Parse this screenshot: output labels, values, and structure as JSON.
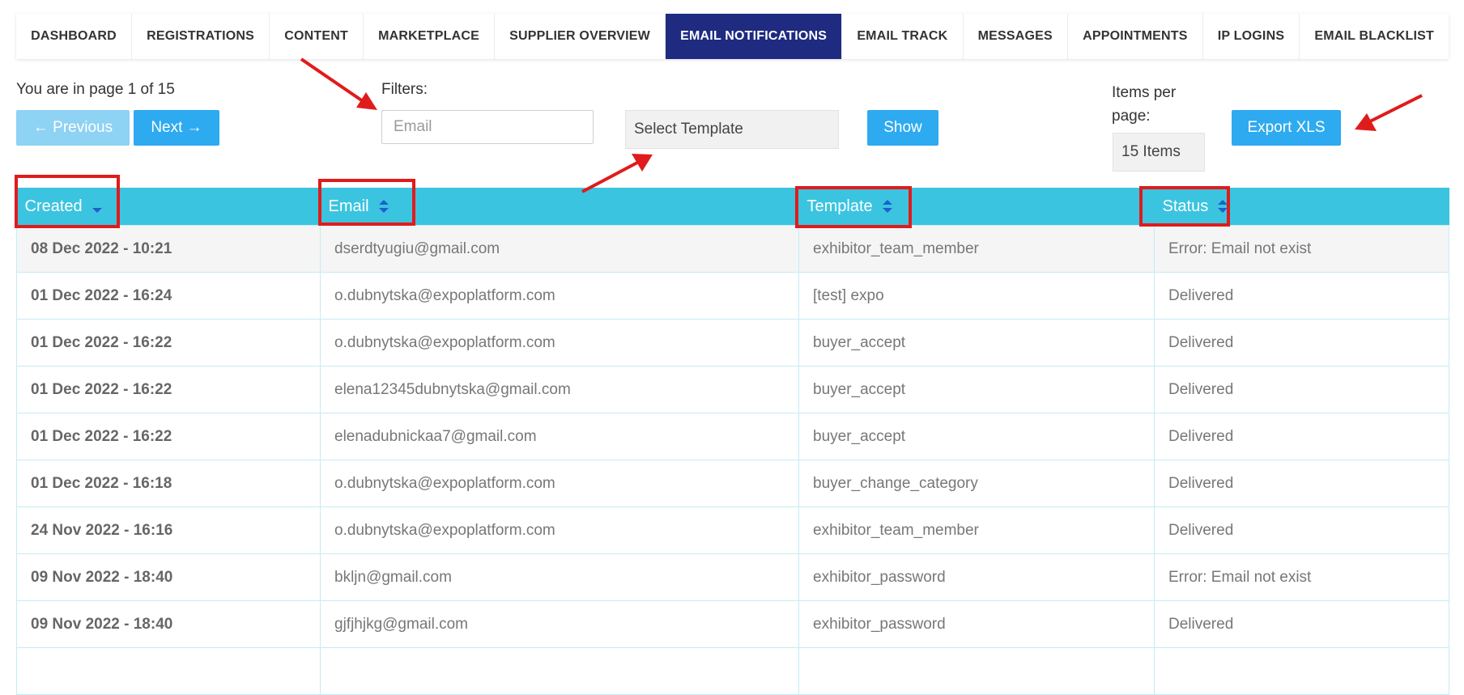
{
  "tabs": [
    {
      "label": "DASHBOARD"
    },
    {
      "label": "REGISTRATIONS"
    },
    {
      "label": "CONTENT"
    },
    {
      "label": "MARKETPLACE"
    },
    {
      "label": "SUPPLIER OVERVIEW"
    },
    {
      "label": "EMAIL NOTIFICATIONS"
    },
    {
      "label": "EMAIL TRACK"
    },
    {
      "label": "MESSAGES"
    },
    {
      "label": "APPOINTMENTS"
    },
    {
      "label": "IP LOGINS"
    },
    {
      "label": "EMAIL BLACKLIST"
    }
  ],
  "active_tab": "EMAIL NOTIFICATIONS",
  "pagination": {
    "page_info": "You are in page 1 of 15",
    "prev_label": "← Previous",
    "next_label": "Next →"
  },
  "filters": {
    "label": "Filters:",
    "email_placeholder": "Email",
    "template_select": "Select Template",
    "show_label": "Show"
  },
  "items_per_page": {
    "label": "Items per page:",
    "value": "15 Items"
  },
  "export_label": "Export XLS",
  "table": {
    "columns": [
      "Created",
      "Email",
      "Template",
      "Status"
    ],
    "rows": [
      {
        "created": "08 Dec 2022 - 10:21",
        "email": "dserdtyugiu@gmail.com",
        "template": "exhibitor_team_member",
        "status": "Error: Email not exist"
      },
      {
        "created": "01 Dec 2022 - 16:24",
        "email": "o.dubnytska@expoplatform.com",
        "template": "[test] expo",
        "status": "Delivered"
      },
      {
        "created": "01 Dec 2022 - 16:22",
        "email": "o.dubnytska@expoplatform.com",
        "template": "buyer_accept",
        "status": "Delivered"
      },
      {
        "created": "01 Dec 2022 - 16:22",
        "email": "elena12345dubnytska@gmail.com",
        "template": "buyer_accept",
        "status": "Delivered"
      },
      {
        "created": "01 Dec 2022 - 16:22",
        "email": "elenadubnickaa7@gmail.com",
        "template": "buyer_accept",
        "status": "Delivered"
      },
      {
        "created": "01 Dec 2022 - 16:18",
        "email": "o.dubnytska@expoplatform.com",
        "template": "buyer_change_category",
        "status": "Delivered"
      },
      {
        "created": "24 Nov 2022 - 16:16",
        "email": "o.dubnytska@expoplatform.com",
        "template": "exhibitor_team_member",
        "status": "Delivered"
      },
      {
        "created": "09 Nov 2022 - 18:40",
        "email": "bkljn@gmail.com",
        "template": "exhibitor_password",
        "status": "Error: Email not exist"
      },
      {
        "created": "09 Nov 2022 - 18:40",
        "email": "gjfjhjkg@gmail.com",
        "template": "exhibitor_password",
        "status": "Delivered"
      },
      {
        "created": "",
        "email": "",
        "template": "",
        "status": ""
      }
    ]
  },
  "colors": {
    "active_tab": "#1e2b80",
    "header_bg": "#3bc4e0",
    "button": "#2eaaf0",
    "button_disabled": "#8ed2f4",
    "annotation": "#e01b1b",
    "sort_icon": "#1e5fd0"
  },
  "icons": {
    "prev": "arrow-left-icon",
    "next": "arrow-right-icon",
    "sort": "sort-icon"
  }
}
